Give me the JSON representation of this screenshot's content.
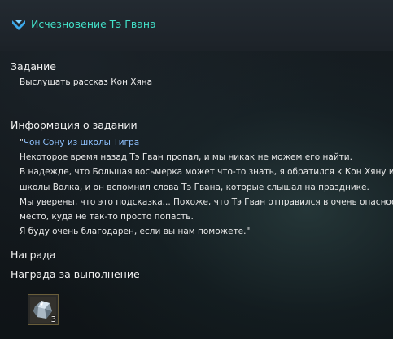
{
  "header": {
    "quest_icon": "chevron-quest-icon",
    "title": "Исчезновение Тэ Гвана",
    "title_color": "#42e0c8"
  },
  "task": {
    "heading": "Задание",
    "text": "Выслушать рассказ Кон Хяна"
  },
  "info": {
    "heading": "Информация о задании",
    "open_quote": "\"",
    "speaker": "Чон Сону из школы Тигра",
    "speaker_color": "#8fc2ff",
    "lines": [
      "Некоторое время назад Тэ Гван пропал, и мы никак не можем его найти.",
      "В надежде, что Большая восьмерка может что-то знать, я обратился к Кон Хяну из",
      "школы Волка, и он вспомнил слова Тэ Гвана, которые слышал на празднике.",
      "Мы уверены, что это подсказка... Похоже, что Тэ Гван отправился в очень опасное",
      "место, куда не так-то просто попасть.",
      "Я буду очень благодарен, если вы нам поможете.\""
    ]
  },
  "reward": {
    "heading": "Награда",
    "completion_heading": "Награда за выполнение",
    "item": {
      "icon": "crystal-ore-icon",
      "count": "3"
    }
  }
}
